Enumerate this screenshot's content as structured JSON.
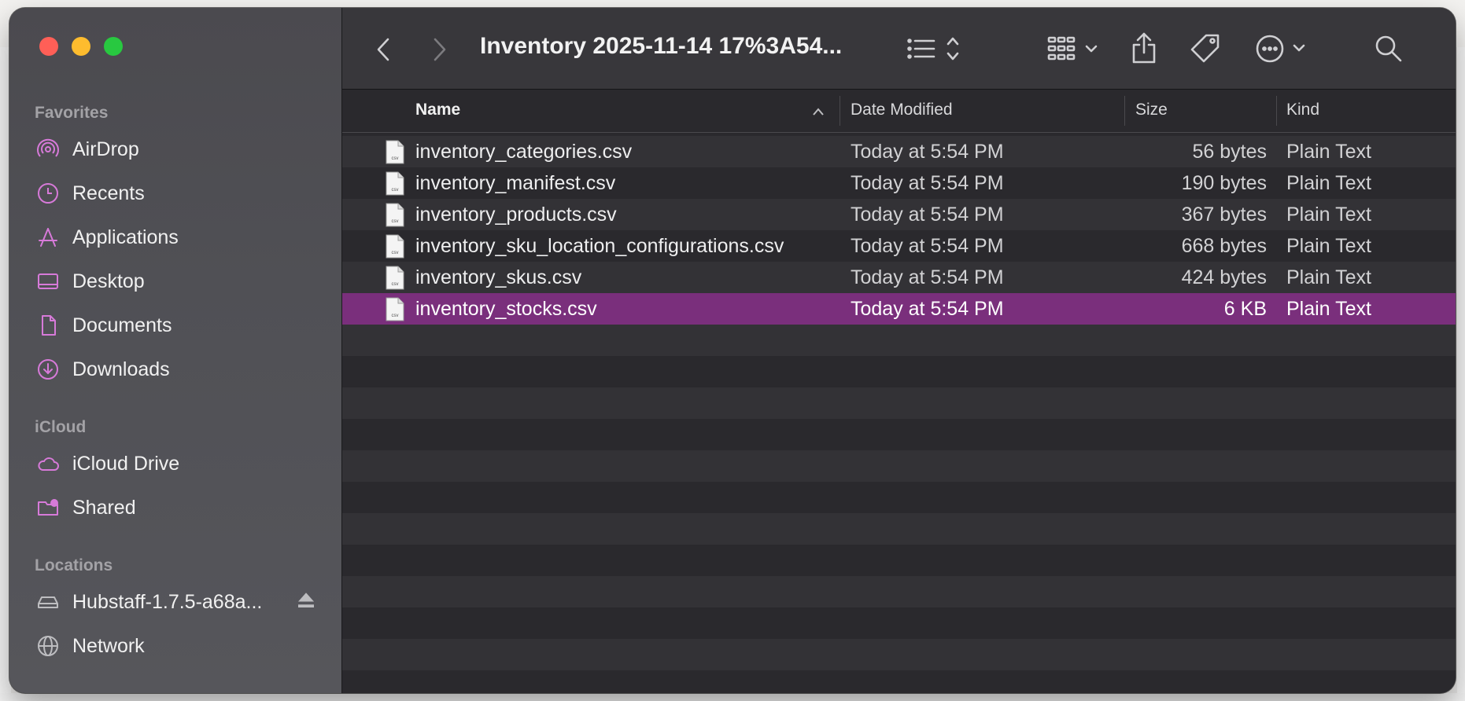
{
  "window": {
    "title": "Inventory 2025-11-14 17%3A54..."
  },
  "sidebar": {
    "favorites_title": "Favorites",
    "favorites": [
      {
        "label": "AirDrop",
        "icon": "airdrop-icon"
      },
      {
        "label": "Recents",
        "icon": "clock-icon"
      },
      {
        "label": "Applications",
        "icon": "applications-icon"
      },
      {
        "label": "Desktop",
        "icon": "desktop-icon"
      },
      {
        "label": "Documents",
        "icon": "document-icon"
      },
      {
        "label": "Downloads",
        "icon": "download-icon"
      }
    ],
    "icloud_title": "iCloud",
    "icloud": [
      {
        "label": "iCloud Drive",
        "icon": "cloud-icon"
      },
      {
        "label": "Shared",
        "icon": "shared-folder-icon"
      }
    ],
    "locations_title": "Locations",
    "locations": [
      {
        "label": "Hubstaff-1.7.5-a68a...",
        "icon": "disk-icon"
      },
      {
        "label": "Network",
        "icon": "globe-icon"
      }
    ],
    "accent_color": "#d77ad9"
  },
  "columns": {
    "name": "Name",
    "date": "Date Modified",
    "size": "Size",
    "kind": "Kind"
  },
  "files": [
    {
      "name": "inventory_categories.csv",
      "date": "Today at 5:54 PM",
      "size": "56 bytes",
      "kind": "Plain Text"
    },
    {
      "name": "inventory_manifest.csv",
      "date": "Today at 5:54 PM",
      "size": "190 bytes",
      "kind": "Plain Text"
    },
    {
      "name": "inventory_products.csv",
      "date": "Today at 5:54 PM",
      "size": "367 bytes",
      "kind": "Plain Text"
    },
    {
      "name": "inventory_sku_location_configurations.csv",
      "date": "Today at 5:54 PM",
      "size": "668 bytes",
      "kind": "Plain Text"
    },
    {
      "name": "inventory_skus.csv",
      "date": "Today at 5:54 PM",
      "size": "424 bytes",
      "kind": "Plain Text"
    },
    {
      "name": "inventory_stocks.csv",
      "date": "Today at 5:54 PM",
      "size": "6 KB",
      "kind": "Plain Text",
      "selected": true
    }
  ],
  "file_icon_label": "csv",
  "selection_color": "#7a2f7c"
}
